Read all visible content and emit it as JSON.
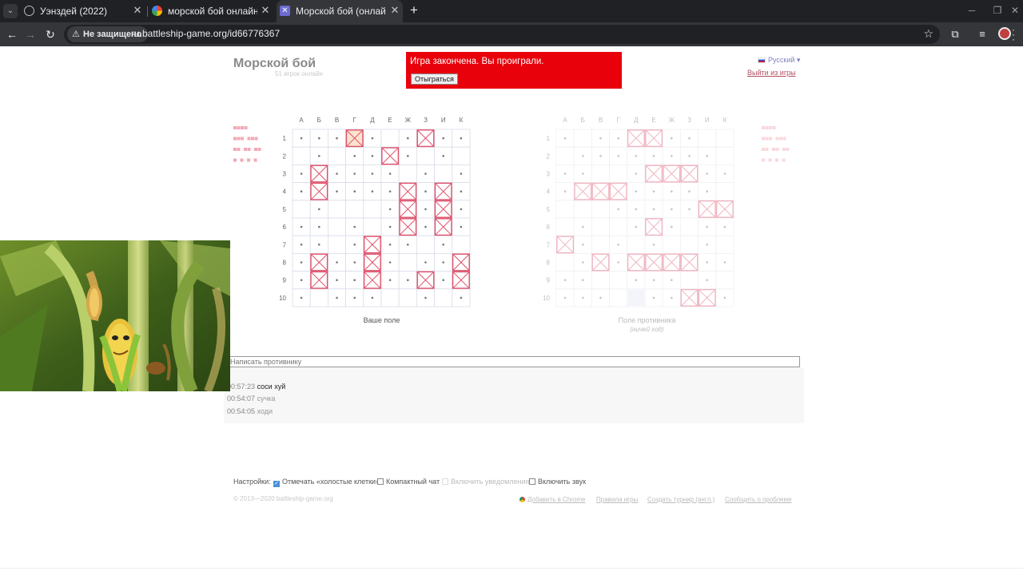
{
  "browser": {
    "tabs": [
      {
        "title": "Уэнздей (2022)",
        "icon": "globe-icon"
      },
      {
        "title": "морской бой онлайн - Поиск",
        "icon": "google-icon"
      },
      {
        "title": "Морской бой (онлайн-игра д",
        "icon": "battleship-favicon"
      }
    ],
    "new_tab": "+",
    "security_label": "Не защищено",
    "url": "ru.battleship-game.org/id66776367"
  },
  "site": {
    "title": "Морской бой",
    "online_count": "51 игрок онлайн",
    "language": "Русский",
    "leave_game": "Выйти из игры"
  },
  "banner": {
    "message": "Игра закончена. Вы проиграли.",
    "rematch_button": "Отыграться",
    "color": "#e8000b"
  },
  "columns": [
    "А",
    "Б",
    "В",
    "Г",
    "Д",
    "Е",
    "Ж",
    "З",
    "И",
    "К"
  ],
  "rows": [
    "1",
    "2",
    "3",
    "4",
    "5",
    "6",
    "7",
    "8",
    "9",
    "10"
  ],
  "my_board": {
    "label": "Ваше поле",
    "hits": [
      [
        0,
        3
      ],
      [
        0,
        7
      ],
      [
        1,
        5
      ],
      [
        2,
        1
      ],
      [
        3,
        1
      ],
      [
        3,
        6
      ],
      [
        3,
        8
      ],
      [
        4,
        6
      ],
      [
        4,
        8
      ],
      [
        5,
        6
      ],
      [
        5,
        8
      ],
      [
        6,
        4
      ],
      [
        7,
        1
      ],
      [
        7,
        4
      ],
      [
        7,
        9
      ],
      [
        8,
        1
      ],
      [
        8,
        4
      ],
      [
        8,
        7
      ],
      [
        8,
        9
      ]
    ],
    "highlight": [
      [
        0,
        3
      ]
    ],
    "misses": [
      [
        0,
        0
      ],
      [
        0,
        1
      ],
      [
        0,
        2
      ],
      [
        0,
        4
      ],
      [
        0,
        6
      ],
      [
        0,
        8
      ],
      [
        0,
        9
      ],
      [
        1,
        1
      ],
      [
        1,
        3
      ],
      [
        1,
        4
      ],
      [
        1,
        6
      ],
      [
        1,
        8
      ],
      [
        2,
        0
      ],
      [
        2,
        2
      ],
      [
        2,
        3
      ],
      [
        2,
        4
      ],
      [
        2,
        5
      ],
      [
        2,
        7
      ],
      [
        2,
        9
      ],
      [
        3,
        0
      ],
      [
        3,
        2
      ],
      [
        3,
        3
      ],
      [
        3,
        4
      ],
      [
        3,
        5
      ],
      [
        3,
        7
      ],
      [
        3,
        9
      ],
      [
        4,
        1
      ],
      [
        4,
        5
      ],
      [
        4,
        7
      ],
      [
        4,
        9
      ],
      [
        5,
        0
      ],
      [
        5,
        1
      ],
      [
        5,
        3
      ],
      [
        5,
        5
      ],
      [
        5,
        7
      ],
      [
        5,
        9
      ],
      [
        6,
        0
      ],
      [
        6,
        1
      ],
      [
        6,
        3
      ],
      [
        6,
        5
      ],
      [
        6,
        6
      ],
      [
        6,
        8
      ],
      [
        7,
        0
      ],
      [
        7,
        2
      ],
      [
        7,
        3
      ],
      [
        7,
        5
      ],
      [
        7,
        7
      ],
      [
        7,
        8
      ],
      [
        8,
        0
      ],
      [
        8,
        2
      ],
      [
        8,
        3
      ],
      [
        8,
        5
      ],
      [
        8,
        6
      ],
      [
        8,
        8
      ],
      [
        9,
        0
      ],
      [
        9,
        2
      ],
      [
        9,
        3
      ],
      [
        9,
        4
      ],
      [
        9,
        7
      ],
      [
        9,
        9
      ]
    ]
  },
  "enemy_board": {
    "label": "Поле противника",
    "sublabel": "(ничей ход)",
    "hits": [
      [
        0,
        4
      ],
      [
        0,
        5
      ],
      [
        2,
        5
      ],
      [
        2,
        6
      ],
      [
        2,
        7
      ],
      [
        3,
        1
      ],
      [
        3,
        2
      ],
      [
        3,
        3
      ],
      [
        4,
        8
      ],
      [
        4,
        9
      ],
      [
        5,
        5
      ],
      [
        6,
        0
      ],
      [
        7,
        2
      ],
      [
        7,
        4
      ],
      [
        7,
        5
      ],
      [
        7,
        6
      ],
      [
        7,
        7
      ],
      [
        9,
        7
      ],
      [
        9,
        8
      ]
    ],
    "misses": [
      [
        0,
        0
      ],
      [
        0,
        2
      ],
      [
        0,
        3
      ],
      [
        0,
        6
      ],
      [
        0,
        7
      ],
      [
        1,
        1
      ],
      [
        1,
        2
      ],
      [
        1,
        3
      ],
      [
        1,
        4
      ],
      [
        1,
        5
      ],
      [
        1,
        6
      ],
      [
        1,
        7
      ],
      [
        1,
        8
      ],
      [
        2,
        0
      ],
      [
        2,
        1
      ],
      [
        2,
        4
      ],
      [
        2,
        8
      ],
      [
        2,
        9
      ],
      [
        3,
        0
      ],
      [
        3,
        4
      ],
      [
        3,
        5
      ],
      [
        3,
        6
      ],
      [
        3,
        7
      ],
      [
        3,
        8
      ],
      [
        4,
        3
      ],
      [
        4,
        4
      ],
      [
        4,
        5
      ],
      [
        4,
        6
      ],
      [
        4,
        7
      ],
      [
        5,
        1
      ],
      [
        5,
        4
      ],
      [
        5,
        6
      ],
      [
        5,
        8
      ],
      [
        5,
        9
      ],
      [
        6,
        1
      ],
      [
        6,
        3
      ],
      [
        6,
        5
      ],
      [
        6,
        8
      ],
      [
        7,
        1
      ],
      [
        7,
        3
      ],
      [
        7,
        8
      ],
      [
        7,
        9
      ],
      [
        8,
        0
      ],
      [
        8,
        1
      ],
      [
        8,
        4
      ],
      [
        8,
        5
      ],
      [
        8,
        6
      ],
      [
        8,
        8
      ],
      [
        9,
        0
      ],
      [
        9,
        1
      ],
      [
        9,
        2
      ],
      [
        9,
        5
      ],
      [
        9,
        6
      ],
      [
        9,
        9
      ]
    ],
    "shaded": [
      [
        9,
        4
      ]
    ]
  },
  "fleet_legend": {
    "groups": [
      [
        4
      ],
      [
        3,
        3
      ],
      [
        2,
        2,
        2
      ],
      [
        1,
        1,
        1,
        1
      ]
    ]
  },
  "chat": {
    "placeholder": "Написать противнику",
    "messages": [
      {
        "time": "00:57:23",
        "text": "соси хуй"
      },
      {
        "time": "00:54:07",
        "text": "сучка"
      },
      {
        "time": "00:54:05",
        "text": "ходи"
      }
    ]
  },
  "settings": {
    "label": "Настройки:",
    "options": [
      {
        "label": "Отмечать «холостые клетки»",
        "checked": true,
        "disabled": false
      },
      {
        "label": "Компактный чат",
        "checked": false,
        "disabled": false
      },
      {
        "label": "Включить уведомления",
        "checked": false,
        "disabled": true
      },
      {
        "label": "Включить звук",
        "checked": false,
        "disabled": false
      }
    ]
  },
  "footer": {
    "copyright": "© 2013—2020 battleship-game.org",
    "links": [
      "Добавить в Chrome",
      "Правила игры",
      "Создать турнир (англ.)",
      "Сообщить о проблеме"
    ]
  },
  "colors": {
    "hit": "#e0506a",
    "highlight_fill": "#fbe4cf",
    "grid": "#d8dce8"
  }
}
